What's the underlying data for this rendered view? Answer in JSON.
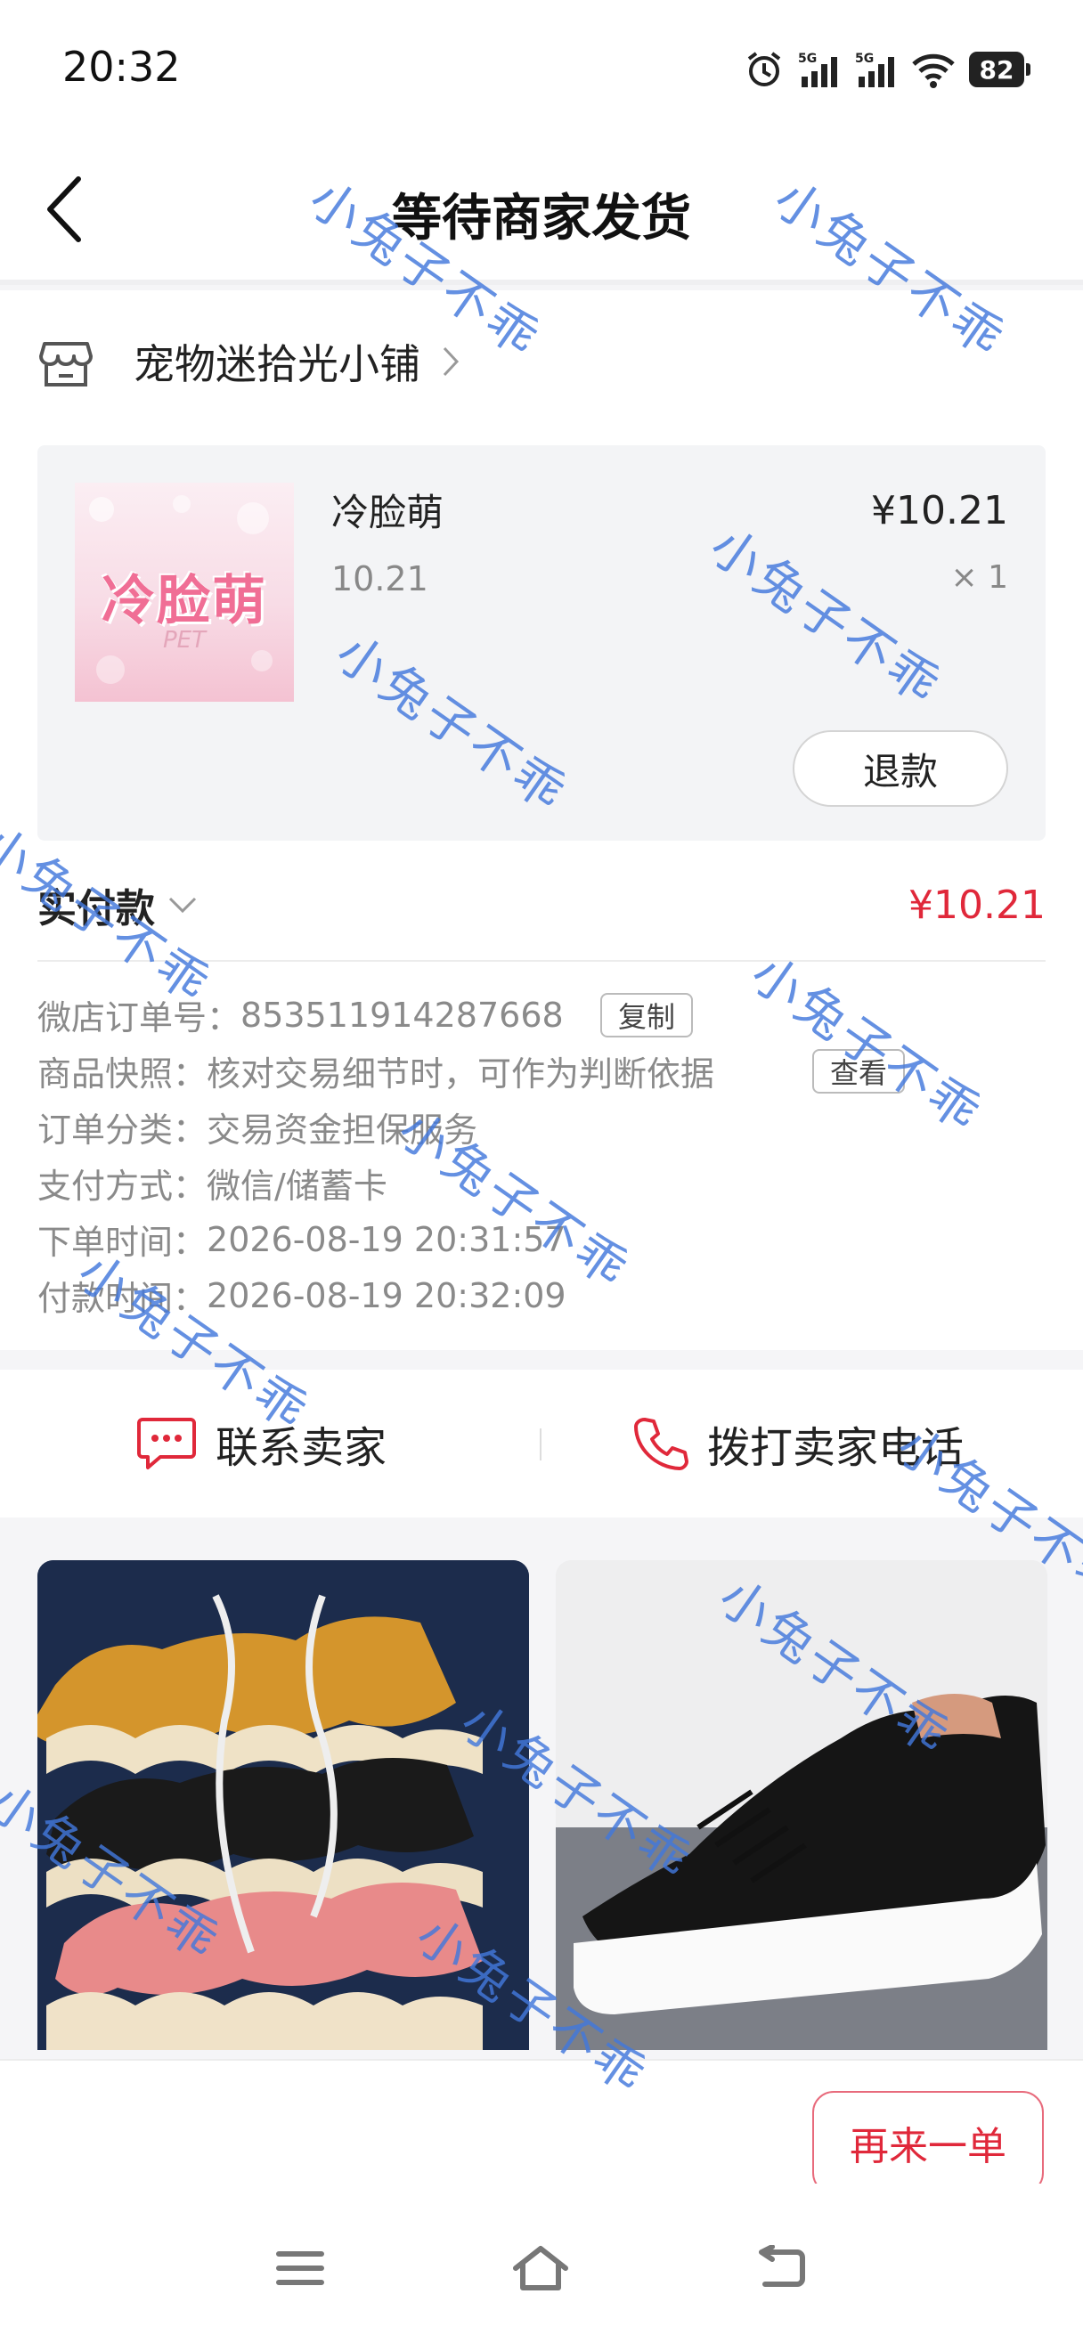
{
  "status_bar": {
    "time": "20:32",
    "battery": "82",
    "icons": [
      "alarm-icon",
      "signal-5g-icon",
      "signal-5g-icon",
      "wifi-icon",
      "battery-icon"
    ]
  },
  "header": {
    "title": "等待商家发货"
  },
  "shop": {
    "name": "宠物迷拾光小铺"
  },
  "product": {
    "thumb_text": "冷脸萌",
    "thumb_sub": "PET",
    "name": "冷脸萌",
    "spec": "10.21",
    "price": "¥10.21",
    "quantity": "× 1",
    "refund_label": "退款"
  },
  "payment": {
    "label": "实付款",
    "amount": "¥10.21"
  },
  "details": {
    "order_no_label": "微店订单号：",
    "order_no": "853511914287668",
    "copy_label": "复制",
    "snapshot_label": "商品快照：",
    "snapshot_text": "核对交易细节时，可作为判断依据",
    "view_label": "查看",
    "category_label": "订单分类：",
    "category": "交易资金担保服务",
    "pay_method_label": "支付方式：",
    "pay_method": "微信/储蓄卡",
    "order_time_label": "下单时间：",
    "order_time": "2026-08-19 20:31:57",
    "pay_time_label": "付款时间：",
    "pay_time": "2026-08-19 20:32:09"
  },
  "contact": {
    "chat_label": "联系卖家",
    "call_label": "拨打卖家电话"
  },
  "bottom": {
    "reorder_label": "再来一单"
  },
  "watermark_text": "小兔子不乖",
  "colors": {
    "accent_red": "#e0283a",
    "watermark_blue": "#4278dc"
  }
}
